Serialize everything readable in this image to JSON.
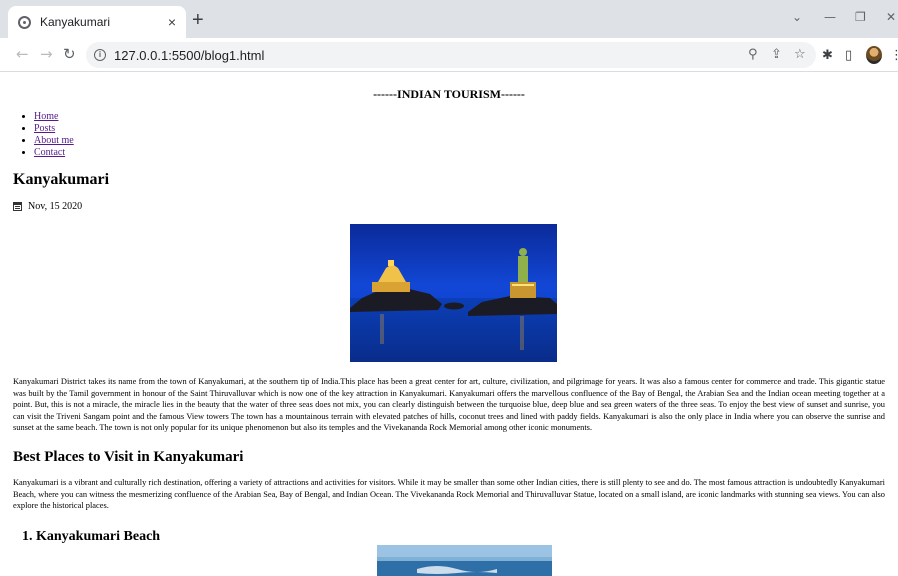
{
  "browser": {
    "tab_title": "Kanyakumari",
    "tab_close": "×",
    "new_tab": "+",
    "url": "127.0.0.1:5500/blog1.html",
    "win_controls": {
      "chevron": "⌄",
      "minimize": "—",
      "restore": "❐",
      "close": "✕"
    },
    "nav": {
      "back": "←",
      "forward": "→",
      "reload": "↻"
    },
    "icons": {
      "zoom": "⚲",
      "share": "⇪",
      "star": "☆",
      "extensions": "✱",
      "sidepanel": "▯",
      "menu": "⋮"
    }
  },
  "site": {
    "title": "------INDIAN TOURISM------",
    "nav": [
      {
        "label": "Home"
      },
      {
        "label": "Posts"
      },
      {
        "label": "About me"
      },
      {
        "label": "Contact"
      }
    ]
  },
  "post": {
    "title": "Kanyakumari",
    "date": "Nov, 15 2020",
    "intro": "Kanyakumari District takes its name from the town of Kanyakumari, at the southern tip of India.This place has been a great center for art, culture, civilization, and pilgrimage for years. It was also a famous center for commerce and trade. This gigantic statue was built by the Tamil government in honour of the Saint Thiruvalluvar which is now one of the key attraction in Kanyakumari. Kanyakumari offers the marvellous confluence of the Bay of Bengal, the Arabian Sea and the Indian ocean meeting together at a point. But, this is not a miracle, the miracle lies in the beauty that the water of three seas does not mix, you can clearly distinguish between the turquoise blue, deep blue and sea green waters of the three seas. To enjoy the best view of sunset and sunrise, you can visit the Triveni Sangam point and the famous View towers The town has a mountainous terrain with elevated patches of hills, coconut trees and lined with paddy fields. Kanyakumari is also the only place in India where you can observe the sunrise and sunset at the same beach. The town is not only popular for its unique phenomenon but also its temples and the Vivekananda Rock Memorial among other iconic monuments.",
    "section_heading": "Best Places to Visit in Kanyakumari",
    "section_text": "Kanyakumari is a vibrant and culturally rich destination, offering a variety of attractions and activities for visitors. While it may be smaller than some other Indian cities, there is still plenty to see and do. The most famous attraction is undoubtedly Kanyakumari Beach, where you can witness the mesmerizing confluence of the Arabian Sea, Bay of Bengal, and Indian Ocean. The Vivekananda Rock Memorial and Thiruvalluvar Statue, located on a small island, are iconic landmarks with stunning sea views. You can also explore the historical places.",
    "sub_heading": "1. Kanyakumari Beach"
  }
}
